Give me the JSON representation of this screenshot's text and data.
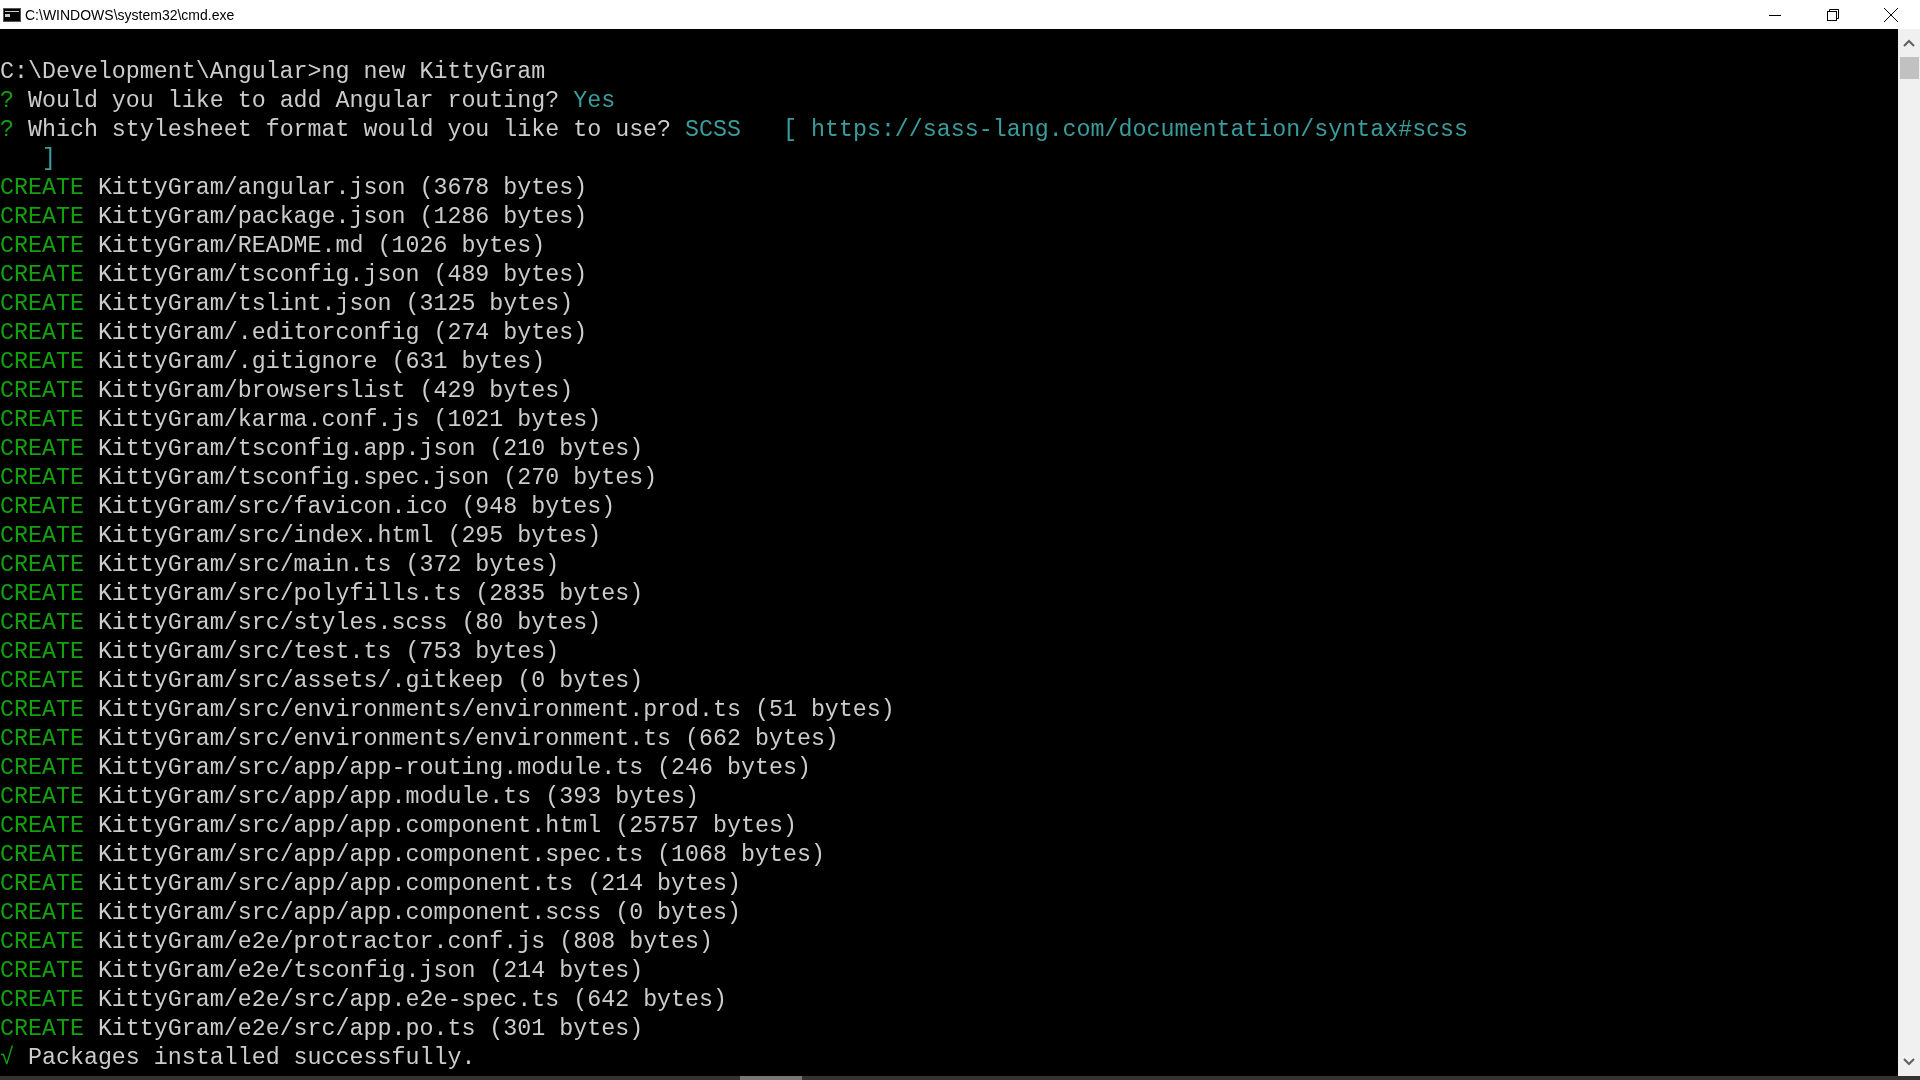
{
  "window": {
    "title": "C:\\WINDOWS\\system32\\cmd.exe"
  },
  "lines": [
    {
      "kind": "command",
      "text": "C:\\Development\\Angular>ng new KittyGram"
    },
    {
      "kind": "prompt",
      "mark": "?",
      "text": "Would you like to add Angular routing?",
      "answer": "Yes"
    },
    {
      "kind": "prompt",
      "mark": "?",
      "text": "Which stylesheet format would you like to use?",
      "answer": "SCSS",
      "hint": "[ https://sass-lang.com/documentation/syntax#scss",
      "hint_end": "]"
    },
    {
      "kind": "create",
      "verb": "CREATE",
      "text": "KittyGram/angular.json (3678 bytes)"
    },
    {
      "kind": "create",
      "verb": "CREATE",
      "text": "KittyGram/package.json (1286 bytes)"
    },
    {
      "kind": "create",
      "verb": "CREATE",
      "text": "KittyGram/README.md (1026 bytes)"
    },
    {
      "kind": "create",
      "verb": "CREATE",
      "text": "KittyGram/tsconfig.json (489 bytes)"
    },
    {
      "kind": "create",
      "verb": "CREATE",
      "text": "KittyGram/tslint.json (3125 bytes)"
    },
    {
      "kind": "create",
      "verb": "CREATE",
      "text": "KittyGram/.editorconfig (274 bytes)"
    },
    {
      "kind": "create",
      "verb": "CREATE",
      "text": "KittyGram/.gitignore (631 bytes)"
    },
    {
      "kind": "create",
      "verb": "CREATE",
      "text": "KittyGram/browserslist (429 bytes)"
    },
    {
      "kind": "create",
      "verb": "CREATE",
      "text": "KittyGram/karma.conf.js (1021 bytes)"
    },
    {
      "kind": "create",
      "verb": "CREATE",
      "text": "KittyGram/tsconfig.app.json (210 bytes)"
    },
    {
      "kind": "create",
      "verb": "CREATE",
      "text": "KittyGram/tsconfig.spec.json (270 bytes)"
    },
    {
      "kind": "create",
      "verb": "CREATE",
      "text": "KittyGram/src/favicon.ico (948 bytes)"
    },
    {
      "kind": "create",
      "verb": "CREATE",
      "text": "KittyGram/src/index.html (295 bytes)"
    },
    {
      "kind": "create",
      "verb": "CREATE",
      "text": "KittyGram/src/main.ts (372 bytes)"
    },
    {
      "kind": "create",
      "verb": "CREATE",
      "text": "KittyGram/src/polyfills.ts (2835 bytes)"
    },
    {
      "kind": "create",
      "verb": "CREATE",
      "text": "KittyGram/src/styles.scss (80 bytes)"
    },
    {
      "kind": "create",
      "verb": "CREATE",
      "text": "KittyGram/src/test.ts (753 bytes)"
    },
    {
      "kind": "create",
      "verb": "CREATE",
      "text": "KittyGram/src/assets/.gitkeep (0 bytes)"
    },
    {
      "kind": "create",
      "verb": "CREATE",
      "text": "KittyGram/src/environments/environment.prod.ts (51 bytes)"
    },
    {
      "kind": "create",
      "verb": "CREATE",
      "text": "KittyGram/src/environments/environment.ts (662 bytes)"
    },
    {
      "kind": "create",
      "verb": "CREATE",
      "text": "KittyGram/src/app/app-routing.module.ts (246 bytes)"
    },
    {
      "kind": "create",
      "verb": "CREATE",
      "text": "KittyGram/src/app/app.module.ts (393 bytes)"
    },
    {
      "kind": "create",
      "verb": "CREATE",
      "text": "KittyGram/src/app/app.component.html (25757 bytes)"
    },
    {
      "kind": "create",
      "verb": "CREATE",
      "text": "KittyGram/src/app/app.component.spec.ts (1068 bytes)"
    },
    {
      "kind": "create",
      "verb": "CREATE",
      "text": "KittyGram/src/app/app.component.ts (214 bytes)"
    },
    {
      "kind": "create",
      "verb": "CREATE",
      "text": "KittyGram/src/app/app.component.scss (0 bytes)"
    },
    {
      "kind": "create",
      "verb": "CREATE",
      "text": "KittyGram/e2e/protractor.conf.js (808 bytes)"
    },
    {
      "kind": "create",
      "verb": "CREATE",
      "text": "KittyGram/e2e/tsconfig.json (214 bytes)"
    },
    {
      "kind": "create",
      "verb": "CREATE",
      "text": "KittyGram/e2e/src/app.e2e-spec.ts (642 bytes)"
    },
    {
      "kind": "create",
      "verb": "CREATE",
      "text": "KittyGram/e2e/src/app.po.ts (301 bytes)"
    },
    {
      "kind": "success",
      "mark": "√",
      "text": "Packages installed successfully."
    }
  ]
}
